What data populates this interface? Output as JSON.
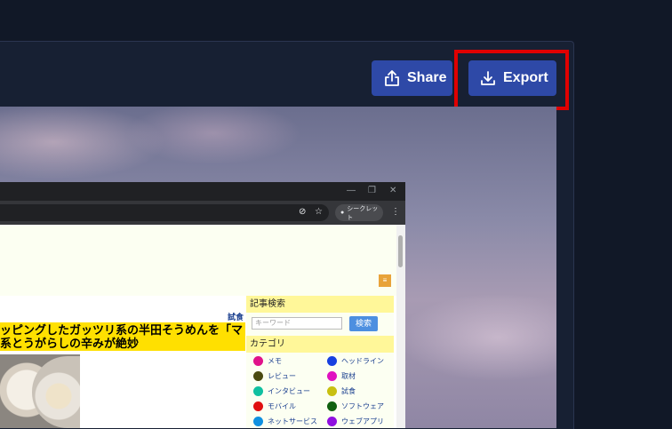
{
  "toolbar": {
    "share_label": "Share",
    "export_label": "Export"
  },
  "browser": {
    "secret_mode_label": "シークレット",
    "page": {
      "shishoku_label": "試食",
      "headline_line1": "ッピングしたガッツリ系の半田そうめんを「マ",
      "headline_line2": "系とうがらしの辛みが絶妙",
      "sidebar": {
        "search_heading": "記事検索",
        "keyword_placeholder": "キーワード",
        "search_button": "検索",
        "category_heading": "カテゴリ",
        "categories": [
          {
            "label": "メモ",
            "color": "#e0128a"
          },
          {
            "label": "ヘッドライン",
            "color": "#1740e0"
          },
          {
            "label": "レビュー",
            "color": "#4a4a10"
          },
          {
            "label": "取材",
            "color": "#e010c0"
          },
          {
            "label": "インタビュー",
            "color": "#10c0a0"
          },
          {
            "label": "試食",
            "color": "#c8c010"
          },
          {
            "label": "モバイル",
            "color": "#e01010"
          },
          {
            "label": "ソフトウェア",
            "color": "#106010"
          },
          {
            "label": "ネットサービス",
            "color": "#1090e0"
          },
          {
            "label": "ウェブアプリ",
            "color": "#9010e0"
          }
        ]
      }
    }
  }
}
